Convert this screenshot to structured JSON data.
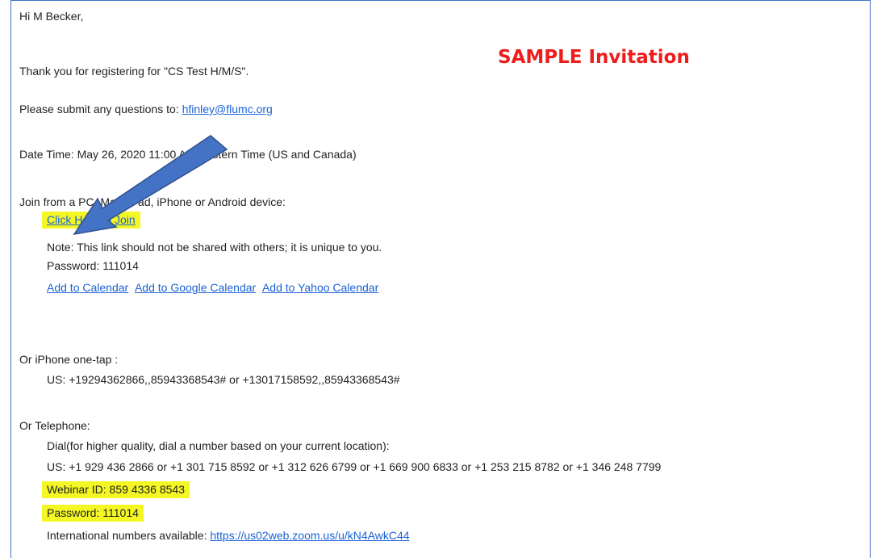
{
  "email": {
    "greeting": "Hi M Becker,",
    "thanks": "Thank you for registering for \"CS Test H/M/S\".",
    "questions_prefix": "Please submit any questions to: ",
    "questions_email": "hfinley@flumc.org",
    "date_time": "Date Time: May 26, 2020 11:00 AM Eastern Time (US and Canada)",
    "join_from": "Join from a PC, Mac, iPad, iPhone or Android device:",
    "join_link": "Click Here to Join",
    "note": "Note: This link should not be shared with others; it is unique to you.",
    "password_line": "Password: 111014",
    "calendar_links": {
      "add_to_calendar": "Add to Calendar",
      "add_to_google": "Add to Google Calendar",
      "add_to_yahoo": "Add to Yahoo Calendar"
    },
    "iphone_heading": "Or iPhone one-tap :",
    "iphone_numbers": "US: +19294362866,,85943368543# or +13017158592,,85943368543#",
    "telephone_heading": "Or Telephone:",
    "dial_note": "Dial(for higher quality, dial a number based on your current location):",
    "us_numbers": "US: +1 929 436 2866 or +1 301 715 8592 or +1 312 626 6799 or +1 669 900 6833 or +1 253 215 8782 or +1 346 248 7799",
    "webinar_id": "Webinar ID: 859 4336 8543",
    "webinar_password": "Password: 111014",
    "international_prefix": "International numbers available: ",
    "international_link": "https://us02web.zoom.us/u/kN4AwkC44"
  },
  "annotation": {
    "sample_label": "SAMPLE Invitation",
    "arrow_color": "#4472c4",
    "label_color": "#ef1c1c",
    "highlight_color": "#f4f724"
  }
}
